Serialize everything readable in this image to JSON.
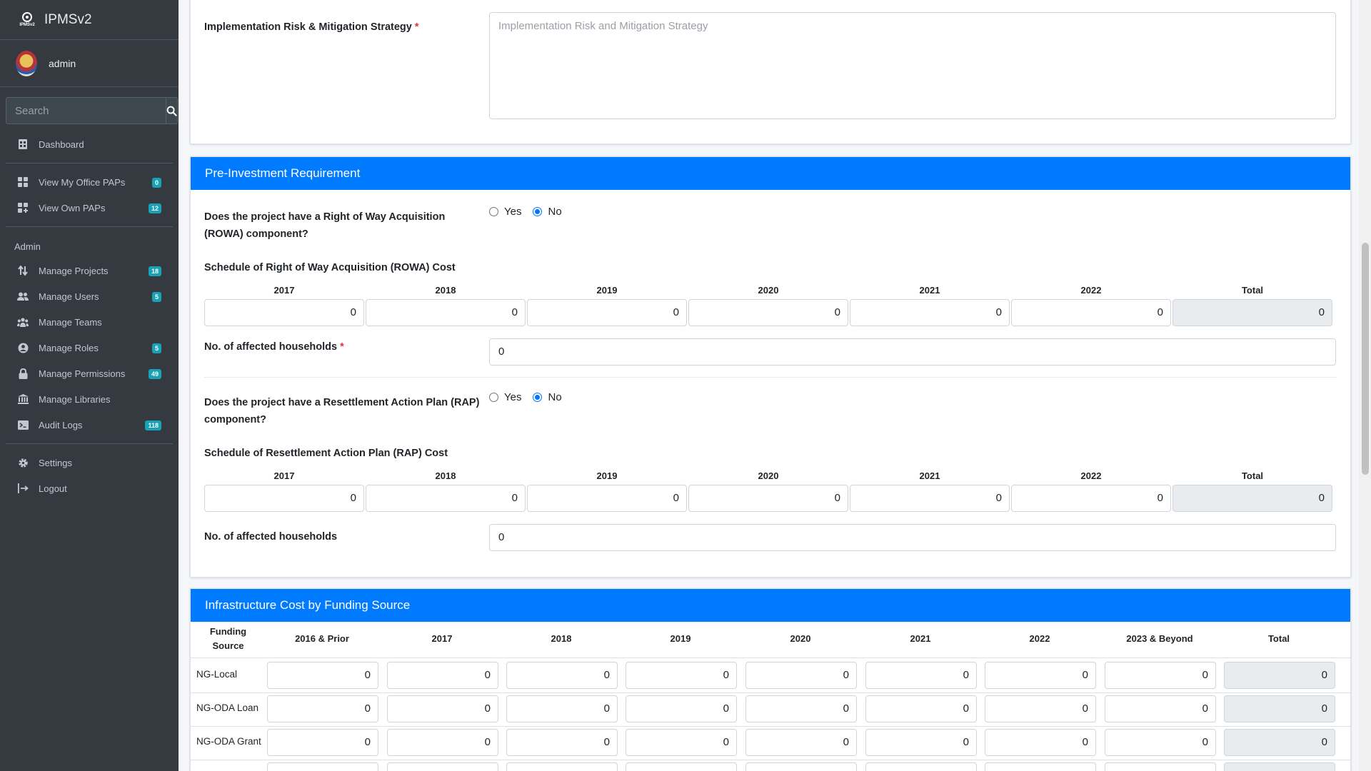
{
  "app": {
    "brand": "IPMSv2",
    "logo_text": "IPMSv2"
  },
  "user": {
    "name": "admin"
  },
  "search": {
    "placeholder": "Search"
  },
  "nav": {
    "dashboard": "Dashboard",
    "view_office_paps": {
      "label": "View My Office PAPs",
      "badge": "0"
    },
    "view_own_paps": {
      "label": "View Own PAPs",
      "badge": "12"
    },
    "admin_header": "Admin",
    "manage_projects": {
      "label": "Manage Projects",
      "badge": "18"
    },
    "manage_users": {
      "label": "Manage Users",
      "badge": "5"
    },
    "manage_teams": {
      "label": "Manage Teams"
    },
    "manage_roles": {
      "label": "Manage Roles",
      "badge": "5"
    },
    "manage_permissions": {
      "label": "Manage Permissions",
      "badge": "49"
    },
    "manage_libraries": {
      "label": "Manage Libraries"
    },
    "audit_logs": {
      "label": "Audit Logs",
      "badge": "118"
    },
    "settings": "Settings",
    "logout": "Logout"
  },
  "risk": {
    "label": "Implementation Risk & Mitigation Strategy",
    "required_mark": "*",
    "placeholder": "Implementation Risk and Mitigation Strategy"
  },
  "preinvest": {
    "title": "Pre-Investment Requirement",
    "rowa_question_line1": "Does the project have a Right of Way Acquisition",
    "rowa_question_line2": "(ROWA) component?",
    "yes": "Yes",
    "no": "No",
    "rowa_selected": "No",
    "rowa_schedule_label": "Schedule of Right of Way Acquisition (ROWA) Cost",
    "years": [
      "2017",
      "2018",
      "2019",
      "2020",
      "2021",
      "2022",
      "Total"
    ],
    "rowa_values": [
      "0",
      "0",
      "0",
      "0",
      "0",
      "0",
      "0"
    ],
    "rowa_households_label": "No. of affected households",
    "required_mark": "*",
    "rowa_households_value": "0",
    "rap_question_line1": "Does the project have a Resettlement Action Plan (RAP)",
    "rap_question_line2": "component?",
    "rap_selected": "No",
    "rap_schedule_label": "Schedule of Resettlement Action Plan (RAP) Cost",
    "rap_values": [
      "0",
      "0",
      "0",
      "0",
      "0",
      "0",
      "0"
    ],
    "rap_households_label": "No. of affected households",
    "rap_households_value": "0"
  },
  "infra": {
    "title": "Infrastructure Cost by Funding Source",
    "headers": [
      "Funding Source",
      "2016 & Prior",
      "2017",
      "2018",
      "2019",
      "2020",
      "2021",
      "2022",
      "2023 & Beyond",
      "Total"
    ],
    "header_fs_line1": "Funding",
    "header_fs_line2": "Source",
    "rows": [
      {
        "source": "NG-Local",
        "values": [
          "0",
          "0",
          "0",
          "0",
          "0",
          "0",
          "0",
          "0",
          "0"
        ]
      },
      {
        "source": "NG-ODA Loan",
        "values": [
          "0",
          "0",
          "0",
          "0",
          "0",
          "0",
          "0",
          "0",
          "0"
        ]
      },
      {
        "source": "NG-ODA Grant",
        "values": [
          "0",
          "0",
          "0",
          "0",
          "0",
          "0",
          "0",
          "0",
          "0"
        ]
      }
    ]
  }
}
